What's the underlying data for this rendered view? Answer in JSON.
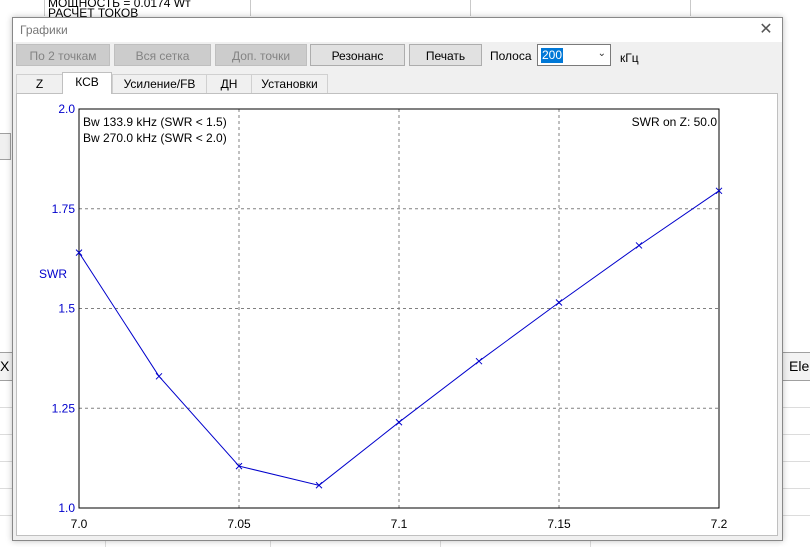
{
  "background": {
    "line1": "МОЩНОСТЬ = 0.0174 Wт",
    "line2": "РАСЧЕТ ТОКОВ",
    "left_cell": "X (",
    "right_cell": "Ele"
  },
  "window": {
    "title": "Графики"
  },
  "toolbar": {
    "btn_two_points": "По 2 точкам",
    "btn_full_grid": "Вся сетка",
    "btn_extra_points": "Доп. точки",
    "btn_resonance": "Резонанс",
    "btn_print": "Печать",
    "band_label": "Полоса",
    "band_value": "200",
    "band_unit": "кГц"
  },
  "tabs": [
    {
      "label": "Z"
    },
    {
      "label": "КСВ"
    },
    {
      "label": "Усиление/FB"
    },
    {
      "label": "ДН"
    },
    {
      "label": "Установки"
    }
  ],
  "colors": {
    "series": "#0000cc",
    "axis_labels_y": "#0000cc",
    "grid": "#808080"
  },
  "chart_data": {
    "type": "line",
    "ylabel": "SWR",
    "xlabel": "",
    "xlim": [
      7.0,
      7.2
    ],
    "ylim": [
      1.0,
      2.0
    ],
    "x_ticks": [
      "7.0",
      "7.05",
      "7.1",
      "7.15",
      "7.2"
    ],
    "y_ticks": [
      "1.0",
      "1.25",
      "1.5",
      "1.75",
      "2.0"
    ],
    "grid": true,
    "annotations": {
      "bw1": "Bw 133.9 kHz (SWR < 1.5)",
      "bw2": "Bw 270.0 kHz (SWR < 2.0)",
      "swr_on_z": "SWR on Z: 50.0"
    },
    "series": [
      {
        "x": [
          7.0,
          7.025,
          7.05,
          7.075,
          7.1,
          7.125,
          7.15,
          7.175,
          7.2
        ],
        "y": [
          1.64,
          1.33,
          1.105,
          1.057,
          1.215,
          1.368,
          1.515,
          1.658,
          1.795
        ]
      }
    ]
  }
}
